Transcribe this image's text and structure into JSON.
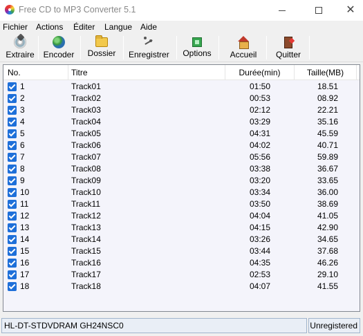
{
  "window": {
    "title": "Free CD to MP3 Converter 5.1"
  },
  "menu": [
    "Fichier",
    "Actions",
    "Éditer",
    "Langue",
    "Aide"
  ],
  "toolbar": {
    "extract": "Extraire",
    "encode": "Encoder",
    "folder": "Dossier",
    "record": "Enregistrer",
    "options": "Options",
    "home": "Accueil",
    "quit": "Quitter"
  },
  "list": {
    "columns": {
      "no": "No.",
      "title": "Titre",
      "duration": "Durée(min)",
      "size": "Taille(MB)"
    },
    "rows": [
      {
        "no": "1",
        "title": "Track01",
        "duration": "01:50",
        "size": "18.51",
        "checked": true
      },
      {
        "no": "2",
        "title": "Track02",
        "duration": "00:53",
        "size": "08.92",
        "checked": true
      },
      {
        "no": "3",
        "title": "Track03",
        "duration": "02:12",
        "size": "22.21",
        "checked": true
      },
      {
        "no": "4",
        "title": "Track04",
        "duration": "03:29",
        "size": "35.16",
        "checked": true
      },
      {
        "no": "5",
        "title": "Track05",
        "duration": "04:31",
        "size": "45.59",
        "checked": true
      },
      {
        "no": "6",
        "title": "Track06",
        "duration": "04:02",
        "size": "40.71",
        "checked": true
      },
      {
        "no": "7",
        "title": "Track07",
        "duration": "05:56",
        "size": "59.89",
        "checked": true
      },
      {
        "no": "8",
        "title": "Track08",
        "duration": "03:38",
        "size": "36.67",
        "checked": true
      },
      {
        "no": "9",
        "title": "Track09",
        "duration": "03:20",
        "size": "33.65",
        "checked": true
      },
      {
        "no": "10",
        "title": "Track10",
        "duration": "03:34",
        "size": "36.00",
        "checked": true
      },
      {
        "no": "11",
        "title": "Track11",
        "duration": "03:50",
        "size": "38.69",
        "checked": true
      },
      {
        "no": "12",
        "title": "Track12",
        "duration": "04:04",
        "size": "41.05",
        "checked": true
      },
      {
        "no": "13",
        "title": "Track13",
        "duration": "04:15",
        "size": "42.90",
        "checked": true
      },
      {
        "no": "14",
        "title": "Track14",
        "duration": "03:26",
        "size": "34.65",
        "checked": true
      },
      {
        "no": "15",
        "title": "Track15",
        "duration": "03:44",
        "size": "37.68",
        "checked": true
      },
      {
        "no": "16",
        "title": "Track16",
        "duration": "04:35",
        "size": "46.26",
        "checked": true
      },
      {
        "no": "17",
        "title": "Track17",
        "duration": "02:53",
        "size": "29.10",
        "checked": true
      },
      {
        "no": "18",
        "title": "Track18",
        "duration": "04:07",
        "size": "41.55",
        "checked": true
      }
    ]
  },
  "status": {
    "drive": "HL-DT-STDVDRAM GH24NSC0",
    "registration": "Unregistered"
  },
  "colors": {
    "checkbox": "#1e6fd9",
    "list_background": "#f4f4fb",
    "status_background": "#e9eef6"
  },
  "icons": {
    "extract": "cd-extract-icon",
    "encode": "globe-encode-icon",
    "folder": "folder-icon",
    "record": "record-icon",
    "options": "options-icon",
    "home": "home-icon",
    "quit": "door-exit-icon"
  }
}
